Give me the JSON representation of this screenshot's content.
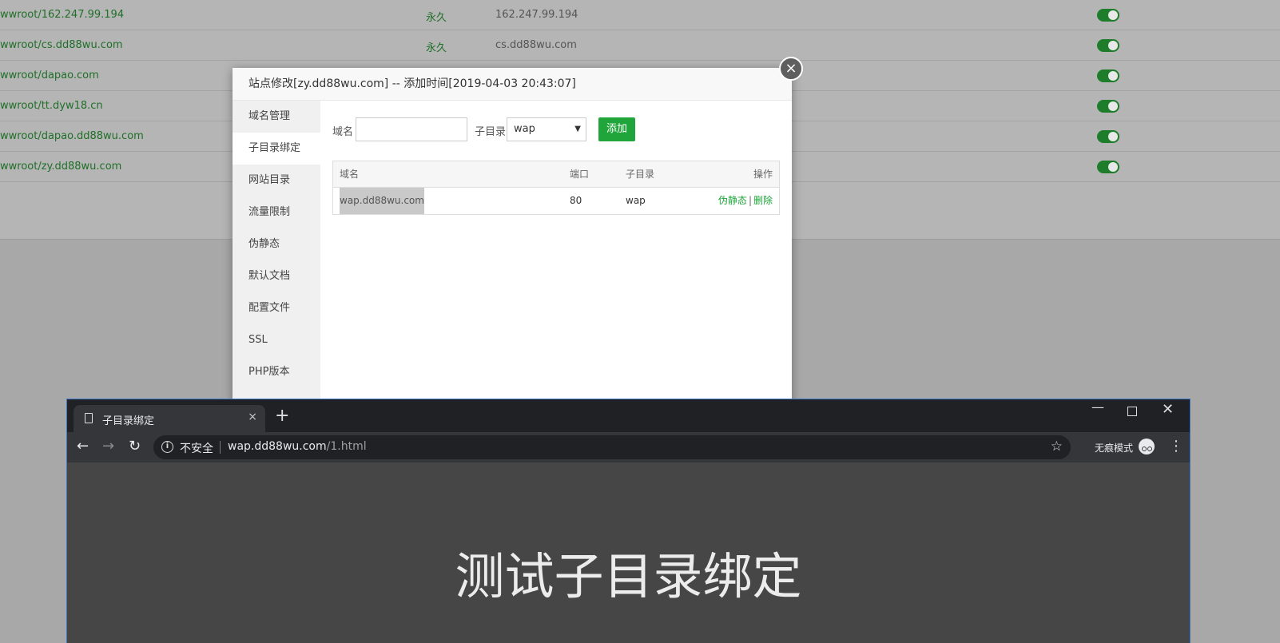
{
  "background_sites": [
    {
      "path": "wwroot/162.247.99.194",
      "expiry": "永久",
      "remark": "162.247.99.194"
    },
    {
      "path": "wwroot/cs.dd88wu.com",
      "expiry": "永久",
      "remark": "cs.dd88wu.com"
    },
    {
      "path": "wwroot/dapao.com",
      "expiry": "",
      "remark": ""
    },
    {
      "path": "wwroot/tt.dyw18.cn",
      "expiry": "",
      "remark": ""
    },
    {
      "path": "wwroot/dapao.dd88wu.com",
      "expiry": "",
      "remark": ""
    },
    {
      "path": "wwroot/zy.dd88wu.com",
      "expiry": "",
      "remark": ""
    }
  ],
  "modal": {
    "title": "站点修改[zy.dd88wu.com] -- 添加时间[2019-04-03 20:43:07]",
    "close_icon": "×",
    "nav": [
      "域名管理",
      "子目录绑定",
      "网站目录",
      "流量限制",
      "伪静态",
      "默认文档",
      "配置文件",
      "SSL",
      "PHP版本"
    ],
    "active_nav": "子目录绑定",
    "form": {
      "domain_label": "域名",
      "domain_value": "",
      "subdir_label": "子目录",
      "subdir_selected": "wap",
      "add_button": "添加"
    },
    "table": {
      "headers": {
        "domain": "域名",
        "port": "端口",
        "subdir": "子目录",
        "action": "操作"
      },
      "rows": [
        {
          "domain": "wap.dd88wu.com",
          "port": "80",
          "subdir": "wap",
          "rewrite": "伪静态",
          "sep": "|",
          "delete": "删除"
        }
      ]
    }
  },
  "browser": {
    "tab_title": "子目录绑定",
    "tab_close": "×",
    "new_tab": "+",
    "insecure_label": "不安全",
    "url_host": "wap.dd88wu.com",
    "url_path": "/1.html",
    "incognito_label": "无痕模式",
    "page_heading": "测试子目录绑定"
  }
}
